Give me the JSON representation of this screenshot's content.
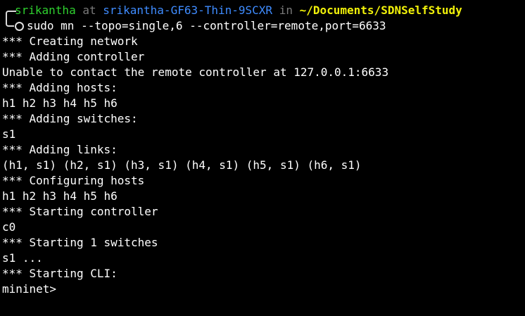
{
  "prompt": {
    "user": "srikantha",
    "at": " at ",
    "host": "srikantha-GF63-Thin-9SCXR",
    "in": " in ",
    "path": "~/Documents/SDNSelfStudy",
    "command": "sudo mn --topo=single,6 --controller=remote,port=6633"
  },
  "output": [
    "*** Creating network",
    "*** Adding controller",
    "Unable to contact the remote controller at 127.0.0.1:6633",
    "*** Adding hosts:",
    "h1 h2 h3 h4 h5 h6",
    "*** Adding switches:",
    "s1",
    "*** Adding links:",
    "(h1, s1) (h2, s1) (h3, s1) (h4, s1) (h5, s1) (h6, s1)",
    "*** Configuring hosts",
    "h1 h2 h3 h4 h5 h6",
    "*** Starting controller",
    "c0",
    "*** Starting 1 switches",
    "s1 ...",
    "*** Starting CLI:",
    "mininet>"
  ],
  "colors": {
    "background": "#000000",
    "user": "#2fd12f",
    "host": "#3f8cff",
    "path": "#f1f10a",
    "dim": "#7a7a7a",
    "text": "#ffffff"
  },
  "icons": {
    "prompt_status": "circle-icon"
  }
}
